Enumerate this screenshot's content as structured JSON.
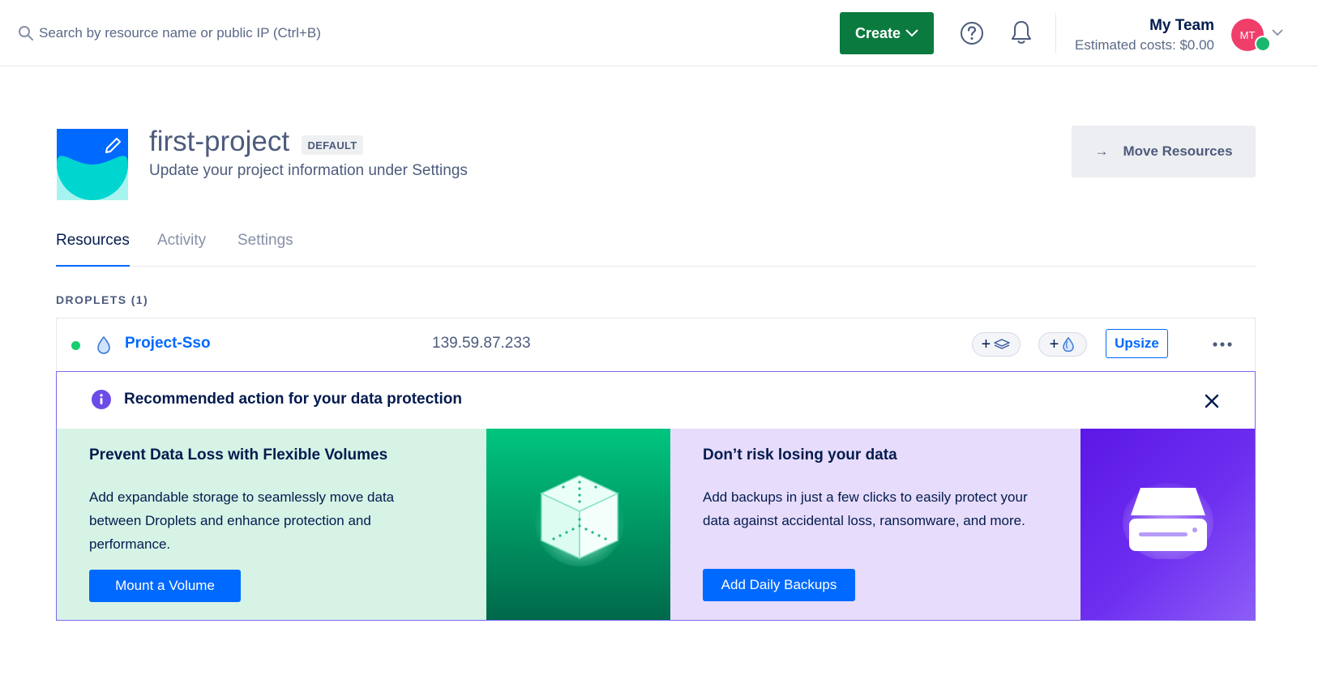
{
  "topbar": {
    "search_placeholder": "Search by resource name or public IP (Ctrl+B)",
    "create_label": "Create",
    "team_name": "My Team",
    "estimated_costs": "Estimated costs: $0.00",
    "avatar_initials": "MT"
  },
  "project": {
    "name": "first-project",
    "badge": "DEFAULT",
    "description": "Update your project information under Settings",
    "move_resources_label": "Move Resources",
    "move_resources_arrow": "→"
  },
  "tabs": [
    {
      "label": "Resources",
      "active": true
    },
    {
      "label": "Activity",
      "active": false
    },
    {
      "label": "Settings",
      "active": false
    }
  ],
  "droplets": {
    "section_title": "DROPLETS (1)",
    "rows": [
      {
        "name": "Project-Sso",
        "ip": "139.59.87.233",
        "status": "active",
        "add_volume_label": "+",
        "add_backup_label": "+",
        "upsize_label": "Upsize"
      }
    ]
  },
  "recommendation": {
    "title": "Recommended action for your data protection",
    "cards": [
      {
        "title": "Prevent Data Loss with Flexible Volumes",
        "text": "Add expandable storage to seamlessly move data between Droplets and enhance protection and performance.",
        "button": "Mount a Volume"
      },
      {
        "title": "Don’t risk losing your data",
        "text": "Add backups in just a few clicks to easily protect your data against accidental loss, ransomware, and more.",
        "button": "Add Daily Backups"
      }
    ]
  },
  "colors": {
    "brand_blue": "#0069ff",
    "create_green": "#0b7a3e",
    "status_green": "#15cd72",
    "panel_border": "#7b68ee"
  },
  "icons": {
    "search": "search-icon",
    "help": "help-icon",
    "notifications": "bell-icon",
    "info": "info-icon",
    "close": "close-icon",
    "more": "more-icon",
    "droplet": "droplet-icon"
  }
}
